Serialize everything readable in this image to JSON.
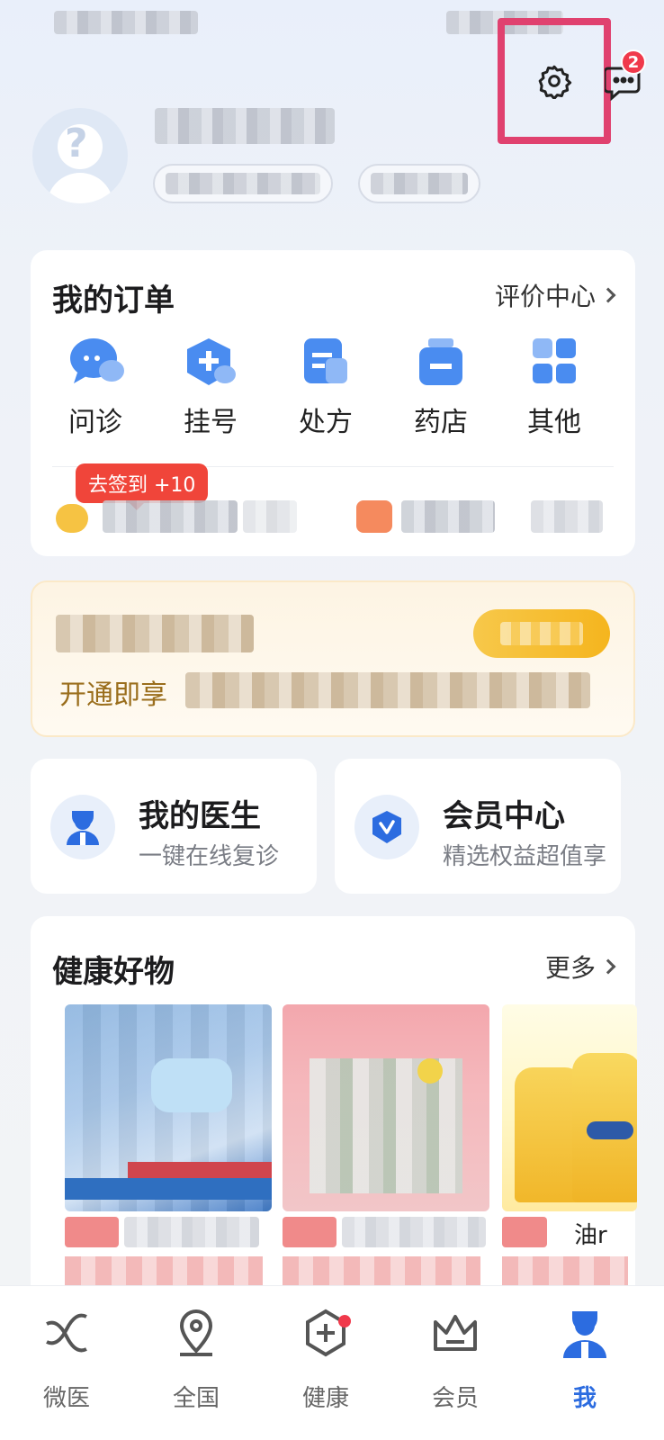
{
  "header": {
    "message_badge_count": "2"
  },
  "orders": {
    "title": "我的订单",
    "review_link": "评价中心",
    "items": [
      {
        "label": "问诊",
        "icon": "chat-bubble-icon"
      },
      {
        "label": "挂号",
        "icon": "hexagon-plus-icon"
      },
      {
        "label": "处方",
        "icon": "document-icon"
      },
      {
        "label": "药店",
        "icon": "medicine-bottle-icon"
      },
      {
        "label": "其他",
        "icon": "grid-icon"
      }
    ],
    "sign_in_badge": "去签到 +10"
  },
  "membership": {
    "description": "开通即享"
  },
  "shortcuts": [
    {
      "title": "我的医生",
      "subtitle": "一键在线复诊",
      "icon": "doctor-icon"
    },
    {
      "title": "会员中心",
      "subtitle": "精选权益超值享",
      "icon": "vip-shield-icon"
    }
  ],
  "goods": {
    "title": "健康好物",
    "more_link": "更多",
    "product3_partial_title": "油r"
  },
  "tabbar": {
    "items": [
      {
        "label": "微医",
        "icon": "weiyi-logo-icon"
      },
      {
        "label": "全国",
        "icon": "location-pin-icon"
      },
      {
        "label": "健康",
        "icon": "health-hex-icon"
      },
      {
        "label": "会员",
        "icon": "crown-icon"
      },
      {
        "label": "我",
        "icon": "user-icon"
      }
    ],
    "active_index": 4
  },
  "colors": {
    "accent_blue": "#2c6ce0",
    "badge_red": "#f0394b",
    "highlight_box": "#e0416f",
    "vip_gold": "#f5b51e"
  }
}
